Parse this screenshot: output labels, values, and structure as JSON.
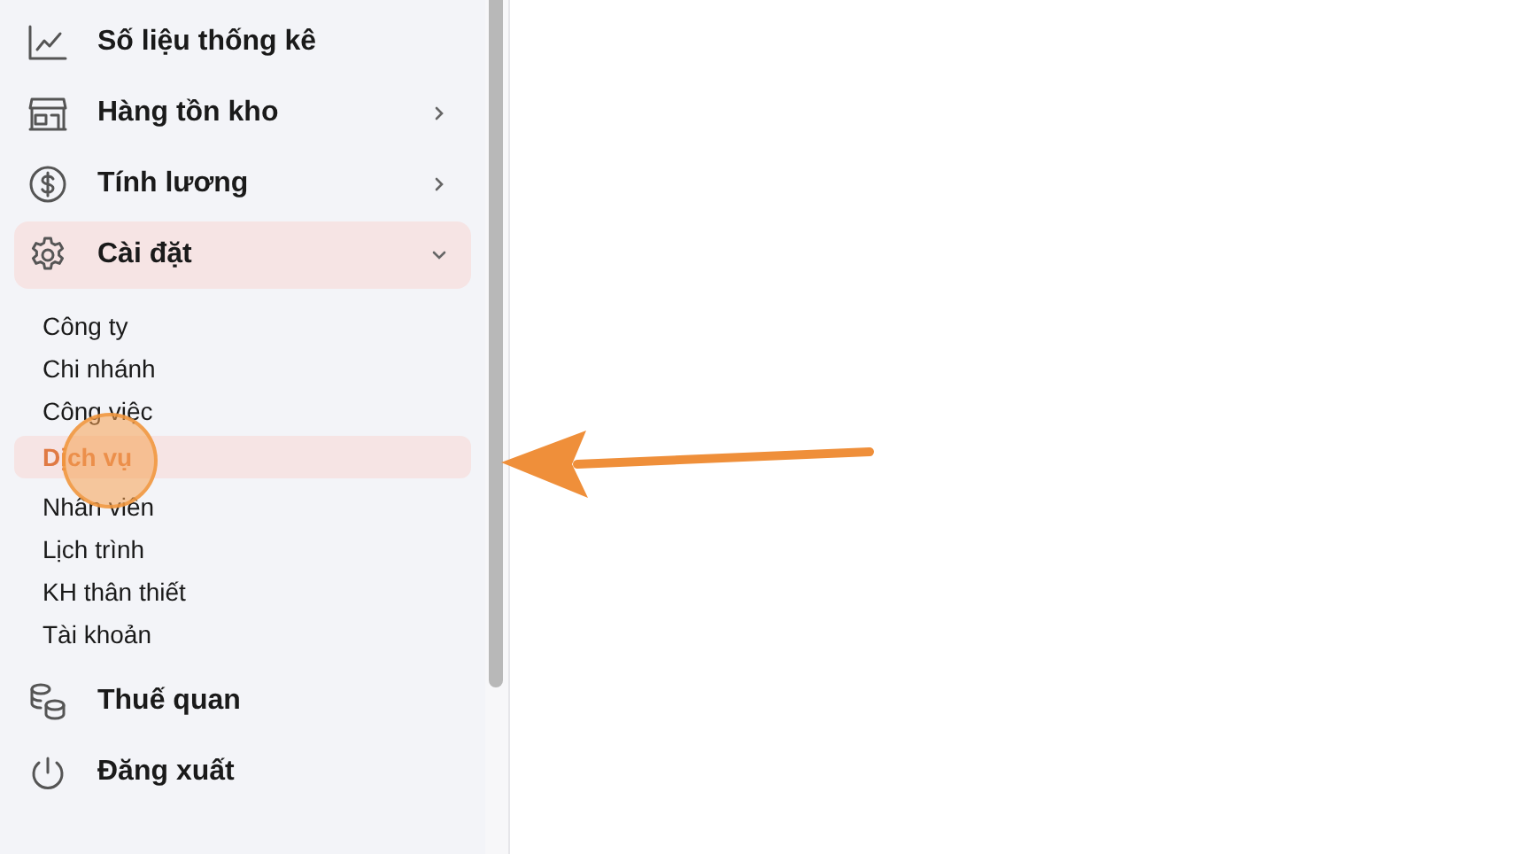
{
  "sidebar": {
    "items": [
      {
        "label": "Số liệu thống kê",
        "kind": "link",
        "selected": false
      },
      {
        "label": "Hàng tồn kho",
        "kind": "group",
        "selected": false,
        "expanded": false
      },
      {
        "label": "Tính lương",
        "kind": "group",
        "selected": false,
        "expanded": false
      },
      {
        "label": "Cài đặt",
        "kind": "group",
        "selected": true,
        "expanded": true,
        "children": [
          {
            "label": "Công ty",
            "selected": false
          },
          {
            "label": "Chi nhánh",
            "selected": false
          },
          {
            "label": "Công việc",
            "selected": false
          },
          {
            "label": "Dịch vụ",
            "selected": true
          },
          {
            "label": "Nhân viên",
            "selected": false
          },
          {
            "label": "Lịch trình",
            "selected": false
          },
          {
            "label": "KH thân thiết",
            "selected": false
          },
          {
            "label": "Tài khoản",
            "selected": false
          }
        ]
      },
      {
        "label": "Thuế quan",
        "kind": "link",
        "selected": false
      },
      {
        "label": "Đăng xuất",
        "kind": "link",
        "selected": false
      }
    ]
  }
}
